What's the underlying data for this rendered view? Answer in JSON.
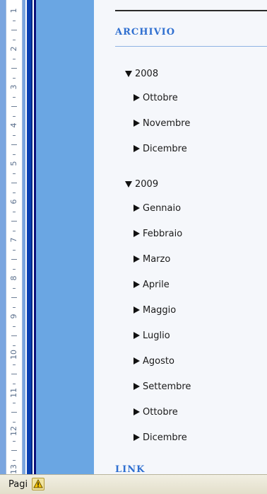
{
  "ruler": {
    "numbers": [
      "1",
      "2",
      "3",
      "4",
      "5",
      "6",
      "7",
      "8",
      "9",
      "10",
      "11",
      "12",
      "13"
    ]
  },
  "archive": {
    "title": "ARCHIVIO",
    "years": [
      {
        "label": "2008",
        "months": [
          "Ottobre",
          "Novembre",
          "Dicembre"
        ]
      },
      {
        "label": "2009",
        "months": [
          "Gennaio",
          "Febbraio",
          "Marzo",
          "Aprile",
          "Maggio",
          "Luglio",
          "Agosto",
          "Settembre",
          "Ottobre",
          "Dicembre"
        ]
      }
    ]
  },
  "links": {
    "title": "LINK"
  },
  "statusbar": {
    "page_label": "Pagi"
  },
  "icons": {
    "year_toggle": "triangle-down-icon",
    "month_bullet": "triangle-right-icon",
    "status_warning": "warning-icon"
  },
  "colors": {
    "section_title": "#2f6fd0",
    "margin_blue": "#6aa6e3",
    "edge_dark": "#0a3fb0"
  }
}
